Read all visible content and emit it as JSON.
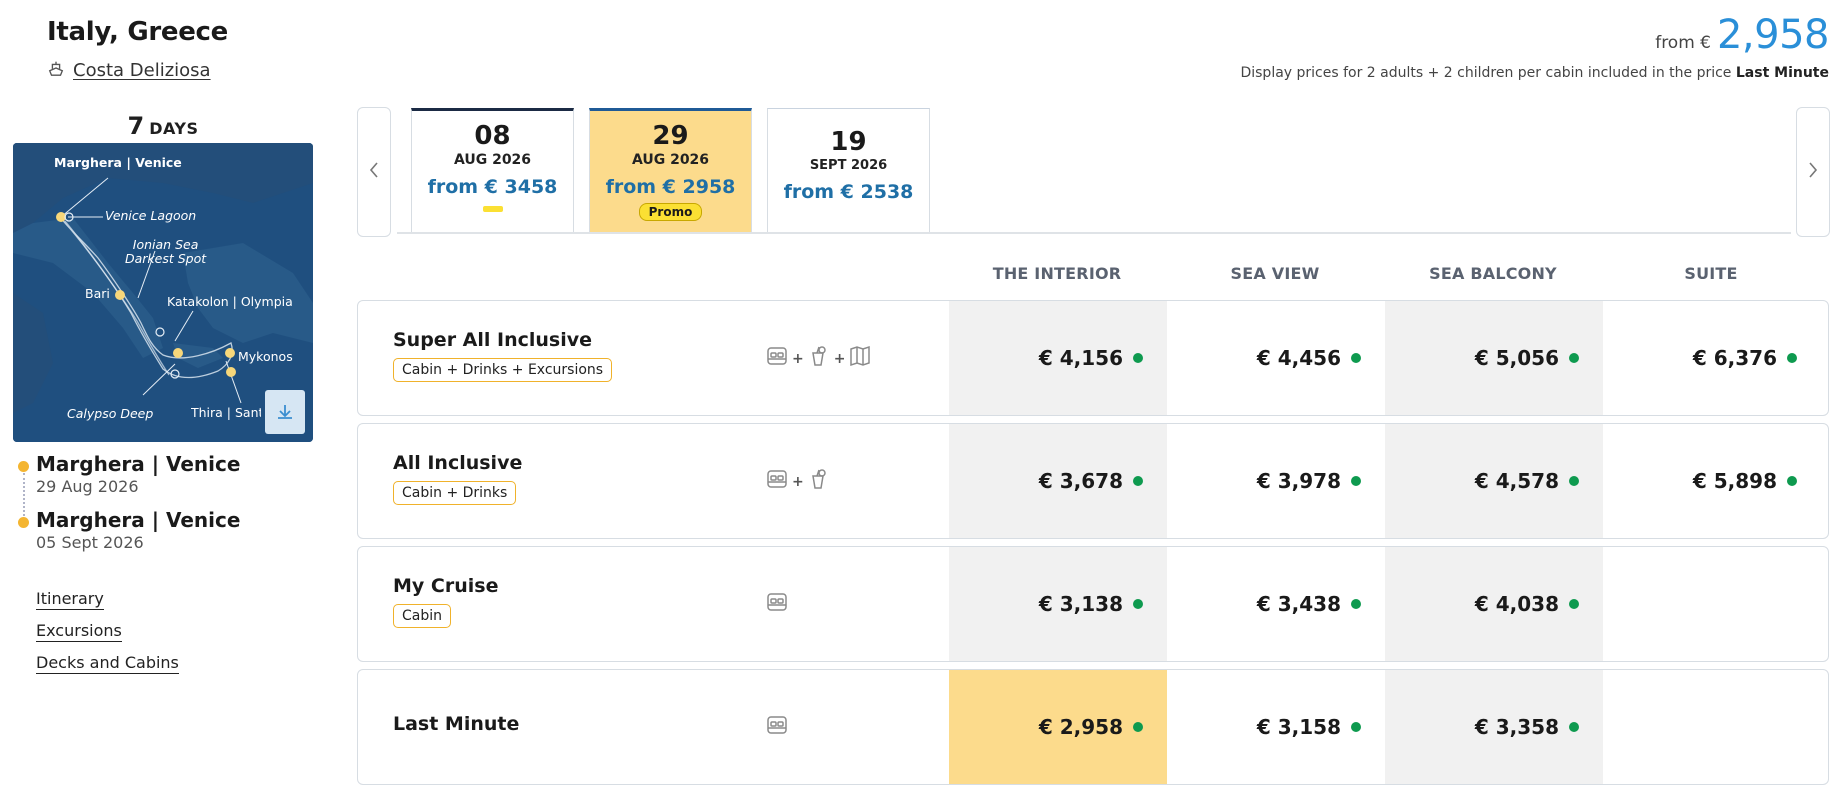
{
  "header": {
    "title": "Italy, Greece",
    "ship_name": "Costa Deliziosa",
    "price_from_label": "from €",
    "price_from_value": "2,958",
    "price_note": "Display prices for 2 adults + 2 children per cabin included in the price",
    "price_note_tag": "Last Minute"
  },
  "left": {
    "days_number": "7",
    "days_label": "DAYS",
    "map_labels": {
      "start": "Marghera | Venice",
      "lagoon": "Venice Lagoon",
      "ionian": "Ionian Sea\nDarkest Spot",
      "bari": "Bari",
      "katakolon": "Katakolon | Olympia",
      "mykonos": "Mykonos",
      "calypso": "Calypso Deep",
      "thira": "Thira | Santorini"
    },
    "stops": [
      {
        "name": "Marghera | Venice",
        "date": "29 Aug 2026"
      },
      {
        "name": "Marghera | Venice",
        "date": "05 Sept 2026"
      }
    ],
    "links": [
      "Itinerary",
      "Excursions",
      "Decks and Cabins"
    ]
  },
  "dates": [
    {
      "day": "08",
      "month": "AUG 2026",
      "price": "from € 3458",
      "badge": ""
    },
    {
      "day": "29",
      "month": "AUG 2026",
      "price": "from € 2958",
      "badge": "Promo"
    },
    {
      "day": "19",
      "month": "SEPT 2026",
      "price": "from € 2538",
      "badge": ""
    }
  ],
  "columns": [
    "THE INTERIOR",
    "SEA VIEW",
    "SEA BALCONY",
    "SUITE"
  ],
  "rows": [
    {
      "plan": "Super All Inclusive",
      "tag": "Cabin + Drinks + Excursions",
      "prices": [
        "€ 4,156",
        "€ 4,456",
        "€ 5,056",
        "€ 6,376"
      ]
    },
    {
      "plan": "All Inclusive",
      "tag": "Cabin + Drinks",
      "prices": [
        "€ 3,678",
        "€ 3,978",
        "€ 4,578",
        "€ 5,898"
      ]
    },
    {
      "plan": "My Cruise",
      "tag": "Cabin",
      "prices": [
        "€ 3,138",
        "€ 3,438",
        "€ 4,038",
        ""
      ]
    },
    {
      "plan": "Last Minute",
      "tag": "",
      "prices": [
        "€ 2,958",
        "€ 3,158",
        "€ 3,358",
        ""
      ]
    }
  ],
  "colors": {
    "accent_blue": "#2a8fd8",
    "highlight_yellow": "#fcdb8c",
    "tag_border": "#f0b22b",
    "availability_green": "#0e9a4f",
    "map_sea": "#1f4f7f"
  },
  "icons": {
    "ship": "ship-icon",
    "bed": "bed-icon",
    "drink": "drink-icon",
    "map": "map-icon",
    "download": "download-icon",
    "prev": "chevron-left-icon",
    "next": "chevron-right-icon"
  }
}
